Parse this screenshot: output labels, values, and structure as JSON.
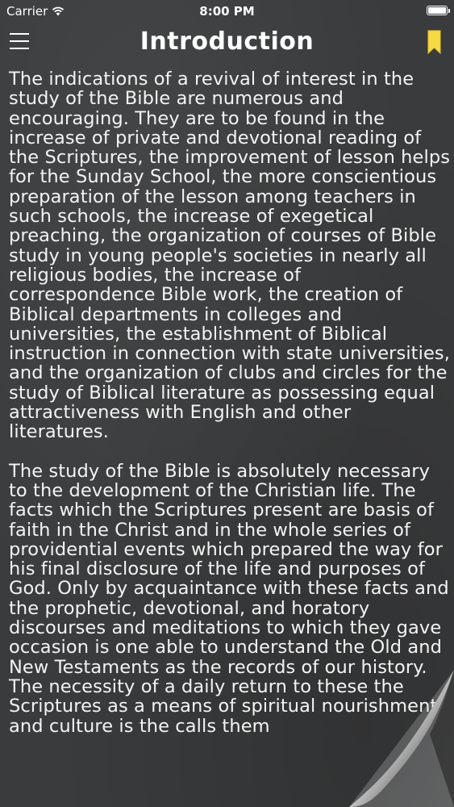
{
  "status_bar": {
    "carrier": "Carrier",
    "time": "8:00 PM",
    "wifi_icon": "wifi-icon",
    "battery_icon": "battery-icon"
  },
  "nav": {
    "title": "Introduction",
    "menu_icon": "hamburger-menu-icon",
    "bookmark_icon": "bookmark-icon",
    "bookmark_color": "#f5d945"
  },
  "content": {
    "paragraphs": [
      "The indications of a revival of interest in the study of the Bible are numerous and encouraging. They are to be found in the increase of private and devotional reading of the Scriptures, the improvement of lesson helps for the Sunday School, the more conscientious preparation of the lesson among teachers in such schools, the increase of exegetical preaching, the organization of courses of Bible study in young people's societies in nearly all religious bodies, the increase of correspondence Bible work, the creation of Biblical departments in colleges and universities, the establishment of Biblical instruction in connection with state universities, and the organization of clubs and circles for the study of Biblical literature as possessing equal attractiveness with English and other literatures.",
      "The study of the Bible is absolutely necessary to the development of the Christian life. The facts which the Scriptures present are basis of faith in the Christ and in the whole series of providential events which prepared the way for his final disclosure of the life and purposes of God. Only by acquaintance with these facts and the prophetic, devotional, and horatory discourses and meditations to which they gave occasion is one able to understand the Old and New Testaments as the records of our history. The necessity of a daily return to these the Scriptures as a means of spiritual nourishment and culture is the calls them"
    ]
  },
  "colors": {
    "background": "#3a3b3c",
    "text": "#f4f4f4",
    "bookmark": "#f5d945"
  }
}
